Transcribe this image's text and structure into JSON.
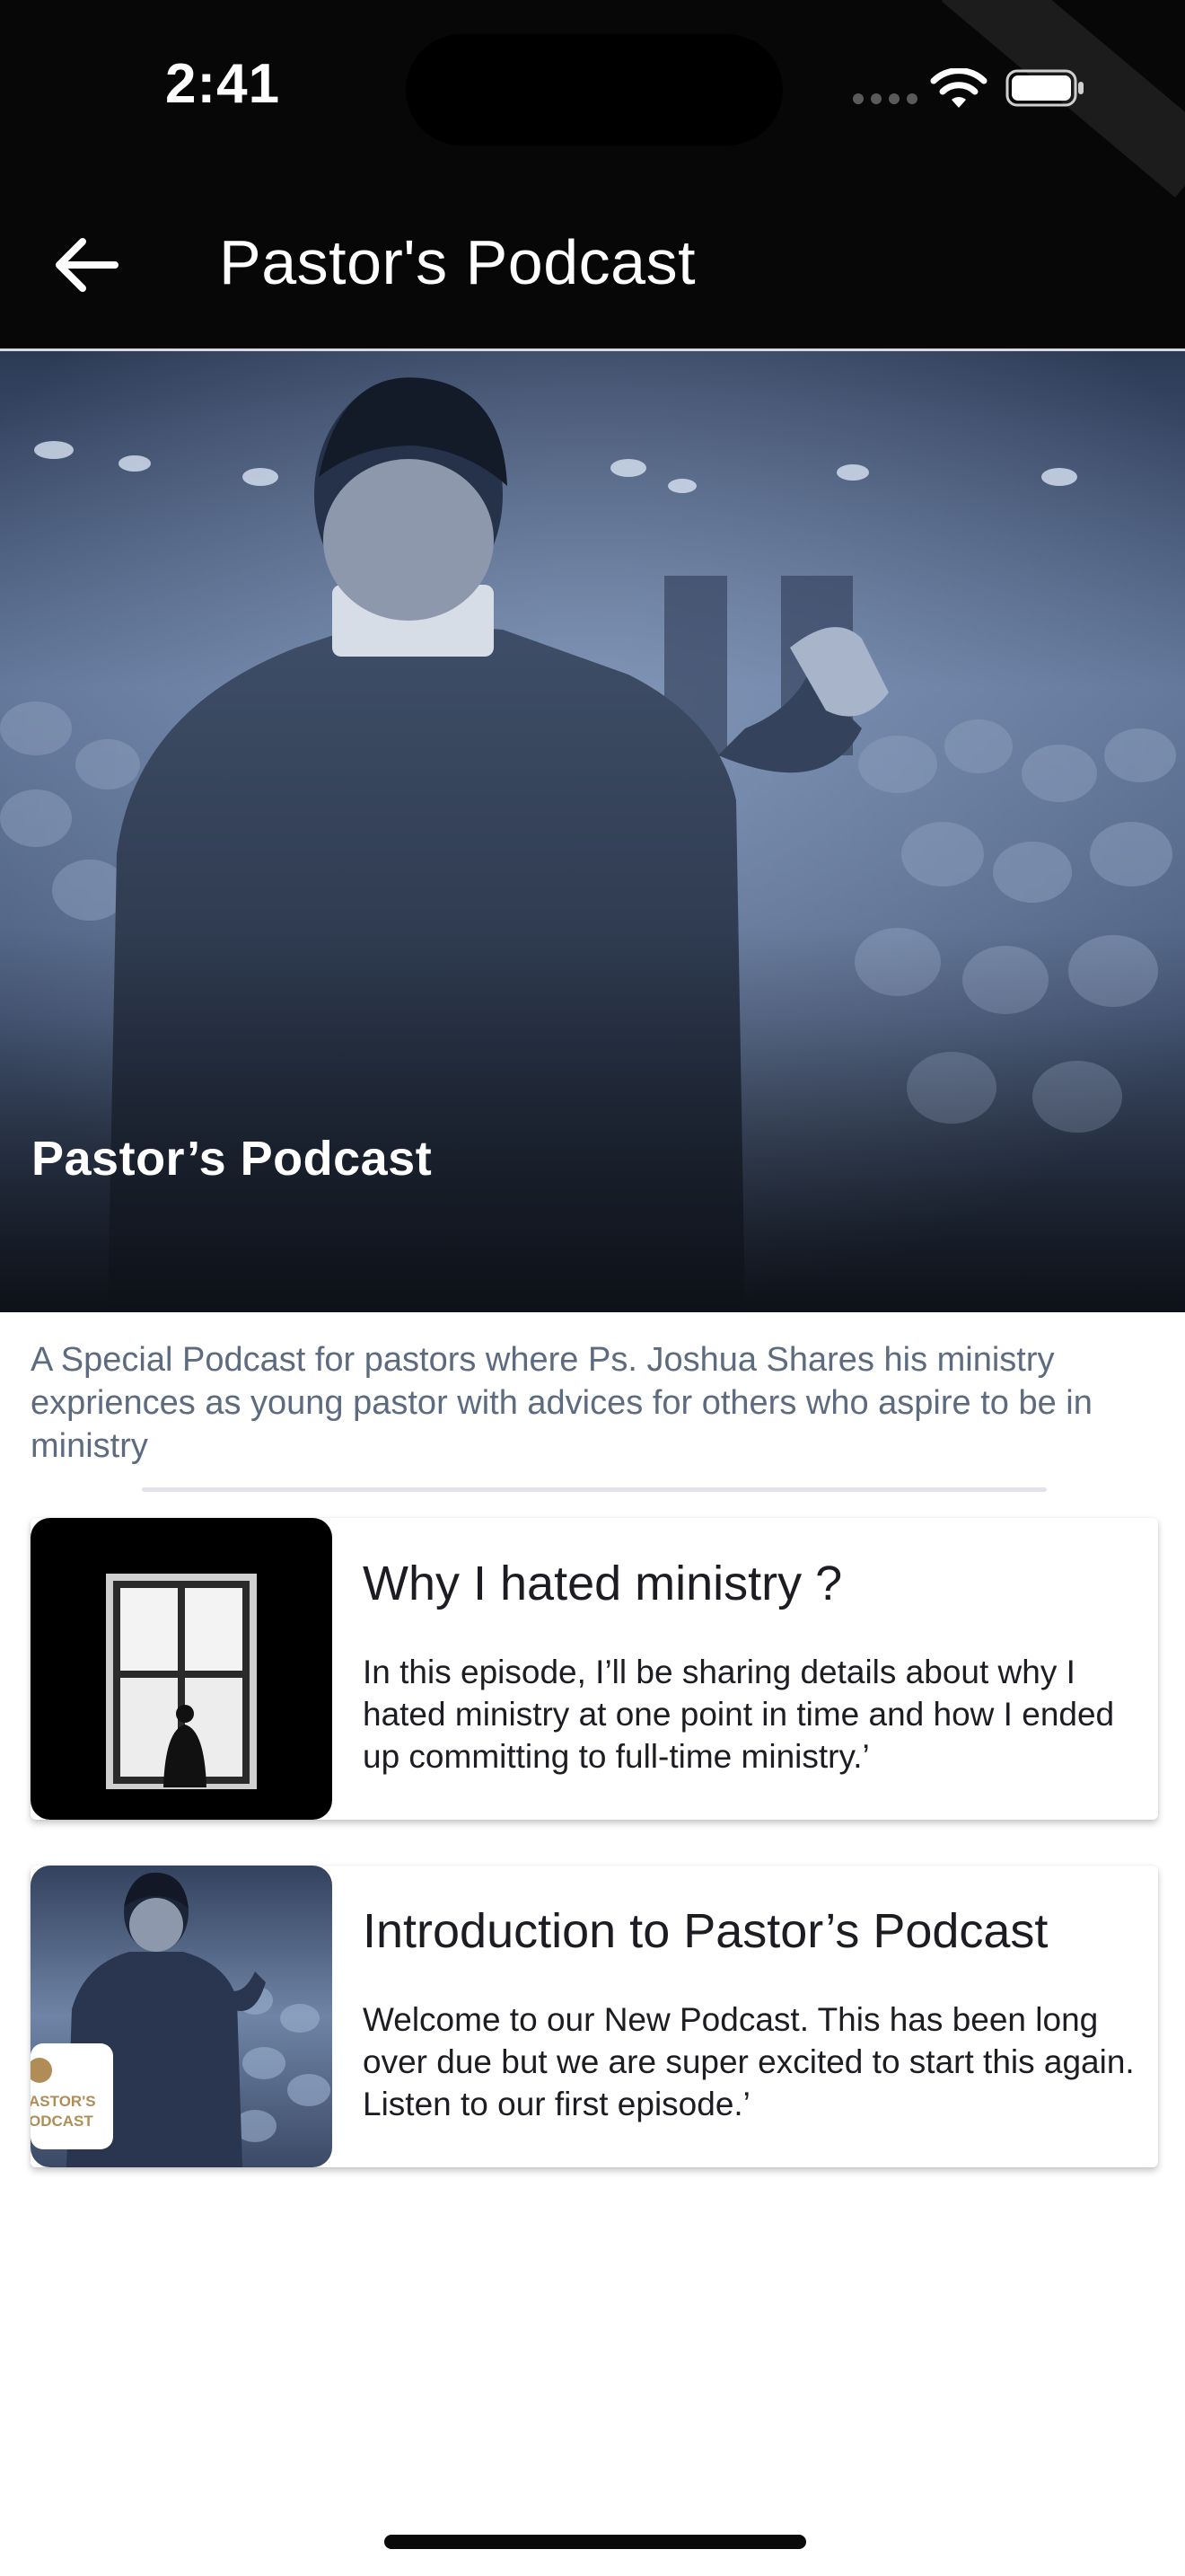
{
  "status_bar": {
    "time": "2:41",
    "icons": [
      "signal-dots-icon",
      "wifi-icon",
      "battery-icon"
    ]
  },
  "app_bar": {
    "back_icon": "arrow-left-icon",
    "title": "Pastor's Podcast"
  },
  "hero": {
    "title": "Pastor’s Podcast"
  },
  "description": "A Special Podcast for pastors where Ps. Joshua Shares his ministry expriences as young pastor with advices for others who aspire to be in ministry",
  "episodes": [
    {
      "title": "Why I hated ministry ?",
      "summary": "In this episode, I’ll be sharing details about why I hated ministry at one point in time and how I ended up committing to full-time ministry.’"
    },
    {
      "title": "Introduction to Pastor’s Podcast",
      "summary": "Welcome to our New Podcast. This has been long over due but we are super excited to start this again. Listen to our first episode.’",
      "badge": "ASTOR'S ODCAST"
    }
  ],
  "colors": {
    "app_bar_bg": "#070707",
    "hero_tint": "#3a4a66",
    "description_text": "#5d6b80",
    "badge_gold": "#b08d57"
  }
}
